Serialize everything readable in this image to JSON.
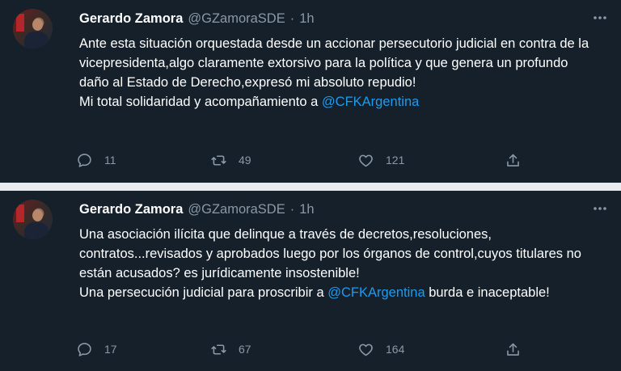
{
  "tweets": [
    {
      "author_name": "Gerardo Zamora",
      "handle": "@GZamoraSDE",
      "separator": "·",
      "time": "1h",
      "paragraph1": "Ante esta situación orquestada desde un accionar persecutorio judicial en contra de la vicepresidenta,algo claramente extorsivo para la política y que genera un profundo daño al Estado de Derecho,expresó mi absoluto repudio!",
      "paragraph2_text": "Mi total solidaridad y acompañamiento a ",
      "paragraph2_mention": "@CFKArgentina",
      "paragraph2_after": "",
      "replies": "11",
      "retweets": "49",
      "likes": "121"
    },
    {
      "author_name": "Gerardo Zamora",
      "handle": "@GZamoraSDE",
      "separator": "·",
      "time": "1h",
      "paragraph1": "Una asociación ilícita que delinque a través de decretos,resoluciones, contratos...revisados y aprobados luego por los órganos de control,cuyos titulares no están acusados? es jurídicamente insostenible!",
      "paragraph2_text": "Una persecución judicial para proscribir a ",
      "paragraph2_mention": "@CFKArgentina",
      "paragraph2_after": " burda e inaceptable!",
      "replies": "17",
      "retweets": "67",
      "likes": "164"
    }
  ],
  "colors": {
    "background": "#15202b",
    "text": "#ffffff",
    "muted": "#8b98a5",
    "link": "#1d9bf0",
    "divider": "#e9ecef"
  },
  "icons": [
    "avatar",
    "more-icon",
    "reply-icon",
    "retweet-icon",
    "like-icon",
    "share-icon"
  ]
}
